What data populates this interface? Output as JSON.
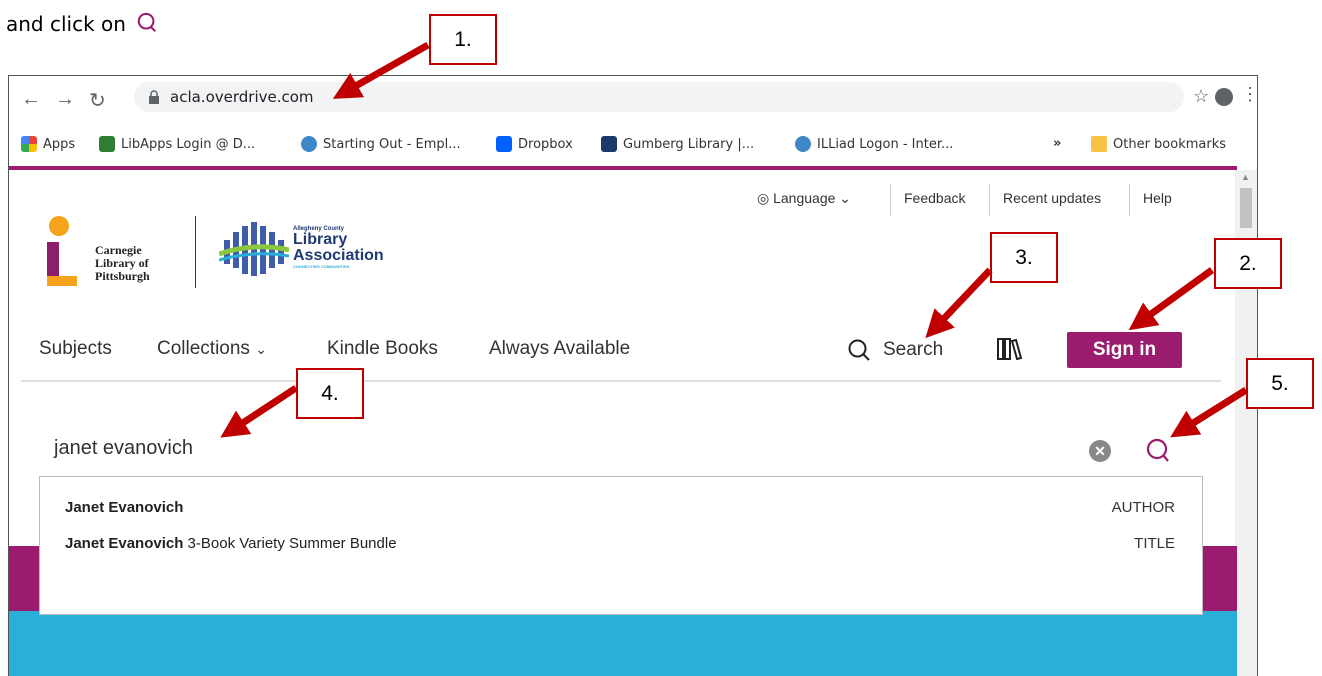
{
  "intro_text": "and click on",
  "browser": {
    "url": "acla.overdrive.com",
    "bookmarks": [
      {
        "label": "Apps",
        "color": "#4285f4"
      },
      {
        "label": "LibApps Login @ D...",
        "color": "#2e7d32"
      },
      {
        "label": "Starting Out - Empl...",
        "color": "#3f88c5"
      },
      {
        "label": "Dropbox",
        "color": "#0061fe"
      },
      {
        "label": "Gumberg Library |...",
        "color": "#1a3a6b"
      },
      {
        "label": "ILLiad Logon - Inter...",
        "color": "#3f88c5"
      }
    ],
    "more_bookmarks": "»",
    "other_bookmarks": "Other bookmarks"
  },
  "site": {
    "utility_nav": {
      "language": "Language",
      "feedback": "Feedback",
      "recent_updates": "Recent updates",
      "help": "Help"
    },
    "logo": {
      "clp_line1": "Carnegie",
      "clp_line2": "Library of",
      "clp_line3": "Pittsburgh",
      "acla_small": "Allegheny County",
      "acla_line1": "Library",
      "acla_line2": "Association",
      "acla_tag": "CONNECTING COMMUNITIES"
    },
    "main_nav": {
      "subjects": "Subjects",
      "collections": "Collections",
      "kindle": "Kindle Books",
      "always": "Always Available",
      "search": "Search",
      "sign_in": "Sign in"
    },
    "search": {
      "value": "janet evanovich"
    },
    "suggestions": [
      {
        "bold": "Janet Evanovich",
        "rest": "",
        "kind": "AUTHOR"
      },
      {
        "bold": "Janet Evanovich",
        "rest": " 3-Book Variety Summer Bundle",
        "kind": "TITLE"
      }
    ]
  },
  "callouts": [
    "1.",
    "2.",
    "3.",
    "4.",
    "5."
  ],
  "colors": {
    "brand": "#9b1b6e",
    "accent_blue": "#2ab0d8",
    "callout_border": "#c00000",
    "arrow": "#c00000"
  }
}
